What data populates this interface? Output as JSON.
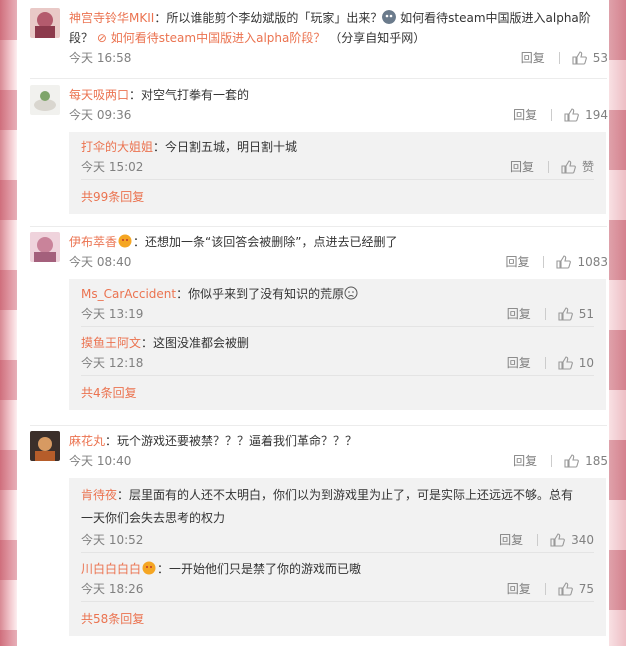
{
  "comments": [
    {
      "user": "神宫寺铃华MKII",
      "text": "：所以谁能剪个李幼斌版的「玩家」出来？",
      "link1": " 如何看待steam中国版进入alpha阶",
      "text_line2_prefix": "段？ ",
      "link2": "如何看待steam中国版进入alpha阶段？",
      "source": "（分享自知乎网）",
      "time": "今天 16:58",
      "reply_label": "回复",
      "likes": "53"
    },
    {
      "user": "每天吸两口",
      "text": "：对空气打拳有一套的",
      "time": "今天 09:36",
      "reply_label": "回复",
      "likes": "194",
      "replies": [
        {
          "user": "打伞的大姐姐",
          "text": "：今日割五城，明日割十城",
          "time": "今天 15:02",
          "reply_label": "回复",
          "likes": "赞"
        }
      ],
      "more": "共99条回复"
    },
    {
      "user": "伊布萃香",
      "text": "：还想加一条“该回答会被删除”，点进去已经删了",
      "time": "今天 08:40",
      "reply_label": "回复",
      "likes": "1083",
      "replies": [
        {
          "user": "Ms_CarAccident",
          "text": "：你似乎来到了没有知识的荒原",
          "time": "今天 13:19",
          "reply_label": "回复",
          "likes": "51"
        },
        {
          "user": "摸鱼王阿文",
          "text": "：这图没准都会被删",
          "time": "今天 12:18",
          "reply_label": "回复",
          "likes": "10"
        }
      ],
      "more": "共4条回复"
    },
    {
      "user": "麻花丸",
      "text": "：玩个游戏还要被禁？？？逼着我们革命？？？",
      "time": "今天 10:40",
      "reply_label": "回复",
      "likes": "185",
      "replies": [
        {
          "user": "肯待夜",
          "text": "：层里面有的人还不太明白，你们以为到游戏里为止了，可是实际上还远远不够。总有",
          "text2": "一天你们会失去思考的权力",
          "time": "今天 10:52",
          "reply_label": "回复",
          "likes": "340"
        },
        {
          "user": "川白白白白",
          "text": "：一开始他们只是禁了你的游戏而已嗷",
          "time": "今天 18:26",
          "reply_label": "回复",
          "likes": "75"
        }
      ],
      "more": "共58条回复"
    }
  ],
  "colors": {
    "username": "#eb7350",
    "meta": "#808080",
    "subpanel": "#f2f2f2"
  }
}
